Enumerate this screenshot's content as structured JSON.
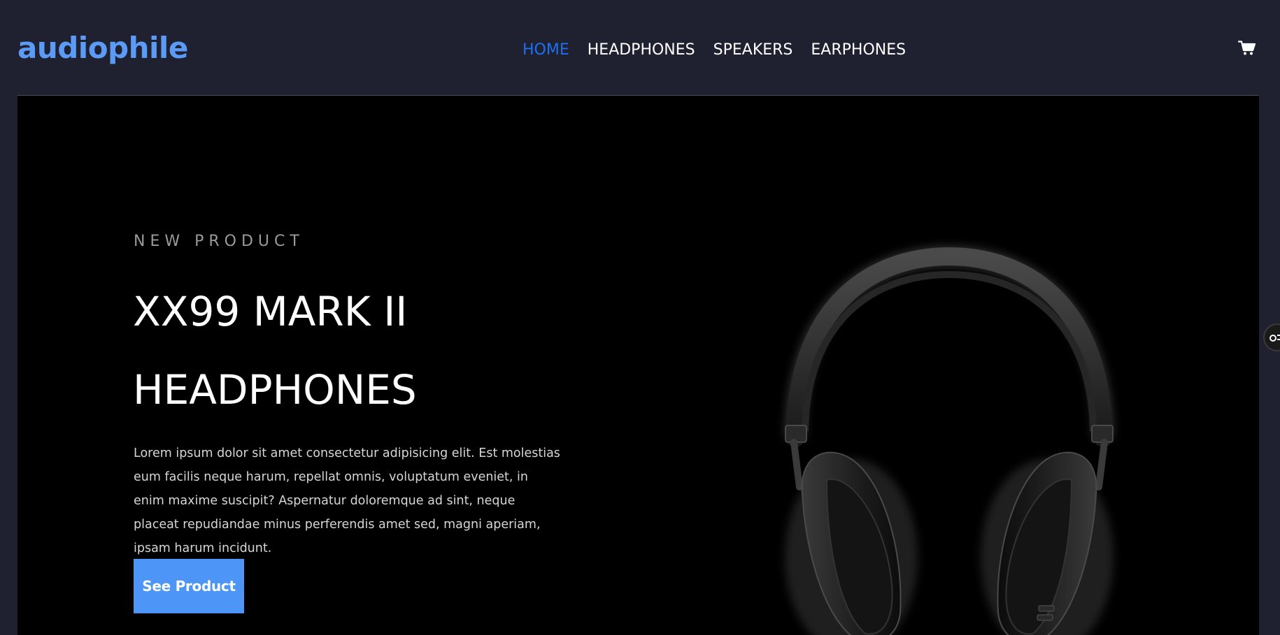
{
  "header": {
    "logo": "audiophile",
    "nav": [
      {
        "label": "HOME",
        "active": true
      },
      {
        "label": "HEADPHONES",
        "active": false
      },
      {
        "label": "SPEAKERS",
        "active": false
      },
      {
        "label": "EARPHONES",
        "active": false
      }
    ],
    "cart_icon": "cart-icon"
  },
  "hero": {
    "eyebrow": "NEW PRODUCT",
    "title_line1": "XX99 MARK II",
    "title_line2": "HEADPHONES",
    "description": "Lorem ipsum dolor sit amet consectetur adipisicing elit. Est molestias eum facilis neque harum, repellat omnis, voluptatum eveniet, in enim maxime suscipit? Aspernatur doloremque ad sint, neque placeat repudiandae minus perferendis amet sed, magni aperiam, ipsam harum incidunt.",
    "cta_label": "See Product",
    "image": "headphones-image"
  },
  "colors": {
    "brand": "#5b9bf5",
    "active_nav": "#1e6ff2",
    "button": "#4d95f7",
    "header_bg": "#1f2130",
    "hero_bg": "#000000"
  },
  "side_widget_icon": "toggle-icon"
}
